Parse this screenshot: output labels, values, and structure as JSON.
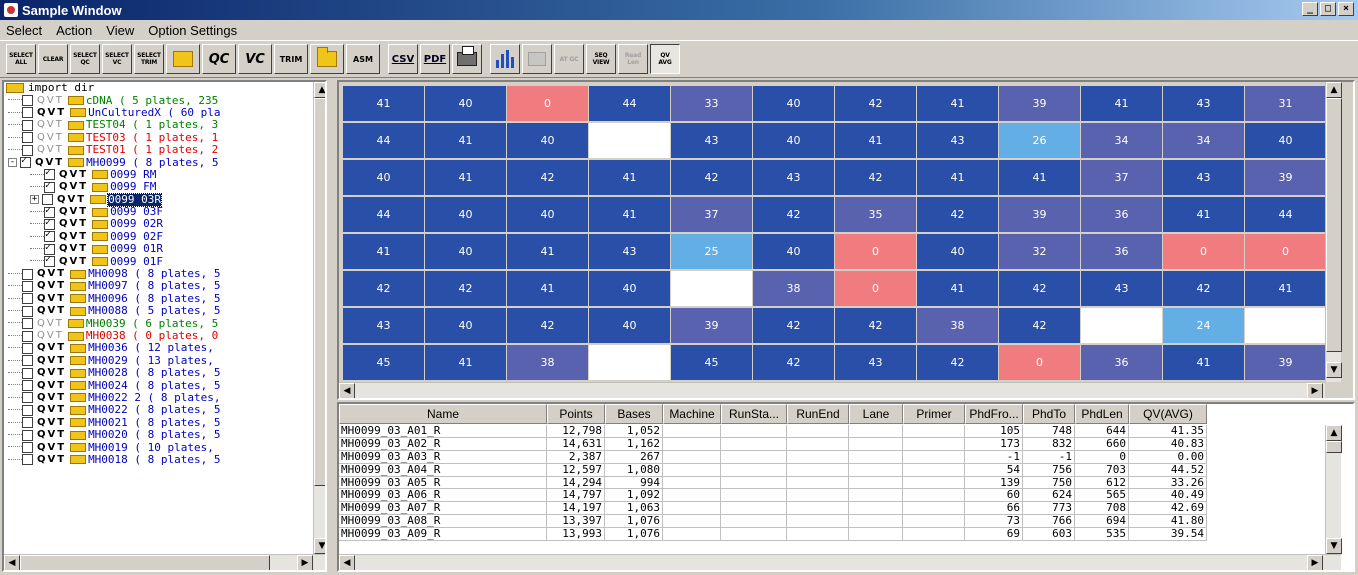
{
  "window": {
    "title": "Sample Window",
    "controls": [
      "_",
      "□",
      "×"
    ]
  },
  "menu": [
    "Select",
    "Action",
    "View",
    "Option Settings"
  ],
  "toolbar": {
    "select_all": "SELECT ALL",
    "clear": "CLEAR",
    "select_qc": "SELECT QC",
    "select_vc": "SELECT VC",
    "select_trim": "SELECT TRIM",
    "qc": "QC",
    "vc": "VC",
    "trim": "TRIM",
    "asm": "ASM",
    "csv": "CSV",
    "pdf": "PDF",
    "seq_view": "SEQ VIEW",
    "read_len": "Read Len",
    "qv_avg": "QV AVG",
    "at_gc": "AT GC"
  },
  "tree": {
    "root": "import dir",
    "items": [
      {
        "label": "cDNA ( 5 plates, 235",
        "checked": false,
        "dim": true,
        "color": "#008000",
        "level": 0
      },
      {
        "label": "UnCulturedX ( 60 pla",
        "checked": false,
        "dim": false,
        "color": "#0000c0",
        "level": 0
      },
      {
        "label": "TEST04 ( 1 plates, 3",
        "checked": false,
        "dim": true,
        "color": "#008000",
        "level": 0
      },
      {
        "label": "TEST03 ( 1 plates, 1",
        "checked": false,
        "dim": true,
        "color": "#e00000",
        "level": 0
      },
      {
        "label": "TEST01 ( 1 plates, 2",
        "checked": false,
        "dim": true,
        "color": "#e00000",
        "level": 0
      },
      {
        "label": "MH0099 ( 8 plates, 5",
        "checked": true,
        "dim": false,
        "color": "#0000c0",
        "level": 0,
        "expander": "-"
      },
      {
        "label": "0099 RM",
        "checked": true,
        "dim": false,
        "color": "#0000c0",
        "level": 1
      },
      {
        "label": "0099 FM",
        "checked": true,
        "dim": false,
        "color": "#0000c0",
        "level": 1
      },
      {
        "label": "0099 03R",
        "checked": false,
        "dim": false,
        "color": "#0000c0",
        "level": 1,
        "expander": "+",
        "selected": true
      },
      {
        "label": "0099 03F",
        "checked": true,
        "dim": false,
        "color": "#0000c0",
        "level": 1
      },
      {
        "label": "0099 02R",
        "checked": true,
        "dim": false,
        "color": "#0000c0",
        "level": 1
      },
      {
        "label": "0099 02F",
        "checked": true,
        "dim": false,
        "color": "#0000c0",
        "level": 1
      },
      {
        "label": "0099 01R",
        "checked": true,
        "dim": false,
        "color": "#0000c0",
        "level": 1
      },
      {
        "label": "0099 01F",
        "checked": true,
        "dim": false,
        "color": "#0000c0",
        "level": 1
      },
      {
        "label": "MH0098 ( 8 plates, 5",
        "checked": false,
        "dim": false,
        "color": "#0000c0",
        "level": 0
      },
      {
        "label": "MH0097 ( 8 plates, 5",
        "checked": false,
        "dim": false,
        "color": "#0000c0",
        "level": 0
      },
      {
        "label": "MH0096 ( 8 plates, 5",
        "checked": false,
        "dim": false,
        "color": "#0000c0",
        "level": 0
      },
      {
        "label": "MH0088 ( 5 plates, 5",
        "checked": false,
        "dim": false,
        "color": "#0000c0",
        "level": 0
      },
      {
        "label": "MH0039 ( 6 plates, 5",
        "checked": false,
        "dim": true,
        "color": "#008000",
        "level": 0
      },
      {
        "label": "MH0038 ( 0 plates, 0",
        "checked": false,
        "dim": true,
        "color": "#e00000",
        "level": 0
      },
      {
        "label": "MH0036 ( 12 plates,",
        "checked": false,
        "dim": false,
        "color": "#0000c0",
        "level": 0
      },
      {
        "label": "MH0029 ( 13 plates,",
        "checked": false,
        "dim": false,
        "color": "#0000c0",
        "level": 0
      },
      {
        "label": "MH0028 ( 8 plates, 5",
        "checked": false,
        "dim": false,
        "color": "#0000c0",
        "level": 0
      },
      {
        "label": "MH0024 ( 8 plates, 5",
        "checked": false,
        "dim": false,
        "color": "#0000c0",
        "level": 0
      },
      {
        "label": "MH0022 2 ( 8 plates,",
        "checked": false,
        "dim": false,
        "color": "#0000c0",
        "level": 0
      },
      {
        "label": "MH0022 ( 8 plates, 5",
        "checked": false,
        "dim": false,
        "color": "#0000c0",
        "level": 0
      },
      {
        "label": "MH0021 ( 8 plates, 5",
        "checked": false,
        "dim": false,
        "color": "#0000c0",
        "level": 0
      },
      {
        "label": "MH0020 ( 8 plates, 5",
        "checked": false,
        "dim": false,
        "color": "#0000c0",
        "level": 0
      },
      {
        "label": "MH0019 ( 10 plates,",
        "checked": false,
        "dim": false,
        "color": "#0000c0",
        "level": 0
      },
      {
        "label": "MH0018 ( 8 plates, 5",
        "checked": false,
        "dim": false,
        "color": "#0000c0",
        "level": 0
      }
    ]
  },
  "heatmap": {
    "colors": {
      "dark": "#2a4fa8",
      "mid": "#5962ae",
      "light": "#64aee6",
      "zero": "#f07c80",
      "empty": "#ffffff"
    },
    "rows": [
      [
        "41",
        "40",
        "0",
        "44",
        "33",
        "40",
        "42",
        "41",
        "39",
        "41",
        "43",
        "31"
      ],
      [
        "44",
        "41",
        "40",
        "",
        "43",
        "40",
        "41",
        "43",
        "26",
        "34",
        "34",
        "40"
      ],
      [
        "40",
        "41",
        "42",
        "41",
        "42",
        "43",
        "42",
        "41",
        "41",
        "37",
        "43",
        "39"
      ],
      [
        "44",
        "40",
        "40",
        "41",
        "37",
        "42",
        "35",
        "42",
        "39",
        "36",
        "41",
        "44"
      ],
      [
        "41",
        "40",
        "41",
        "43",
        "25",
        "40",
        "0",
        "40",
        "32",
        "36",
        "0",
        "0"
      ],
      [
        "42",
        "42",
        "41",
        "40",
        "",
        "38",
        "0",
        "41",
        "42",
        "43",
        "42",
        "41"
      ],
      [
        "43",
        "40",
        "42",
        "40",
        "39",
        "42",
        "42",
        "38",
        "42",
        "",
        "24",
        ""
      ],
      [
        "45",
        "41",
        "38",
        "",
        "45",
        "42",
        "43",
        "42",
        "0",
        "36",
        "41",
        "39"
      ]
    ]
  },
  "table": {
    "columns": [
      "Name",
      "Points",
      "Bases",
      "Machine",
      "RunSta...",
      "RunEnd",
      "Lane",
      "Primer",
      "PhdFro...",
      "PhdTo",
      "PhdLen",
      "QV(AVG)"
    ],
    "rows": [
      [
        "MH0099_03_A01_R",
        "12,798",
        "1,052",
        "",
        "",
        "",
        "",
        "",
        "105",
        "748",
        "644",
        "41.35"
      ],
      [
        "MH0099_03_A02_R",
        "14,631",
        "1,162",
        "",
        "",
        "",
        "",
        "",
        "173",
        "832",
        "660",
        "40.83"
      ],
      [
        "MH0099_03_A03_R",
        "2,387",
        "267",
        "",
        "",
        "",
        "",
        "",
        "-1",
        "-1",
        "0",
        "0.00"
      ],
      [
        "MH0099_03_A04_R",
        "12,597",
        "1,080",
        "",
        "",
        "",
        "",
        "",
        "54",
        "756",
        "703",
        "44.52"
      ],
      [
        "MH0099_03_A05_R",
        "14,294",
        "994",
        "",
        "",
        "",
        "",
        "",
        "139",
        "750",
        "612",
        "33.26"
      ],
      [
        "MH0099_03_A06_R",
        "14,797",
        "1,092",
        "",
        "",
        "",
        "",
        "",
        "60",
        "624",
        "565",
        "40.49"
      ],
      [
        "MH0099_03_A07_R",
        "14,197",
        "1,063",
        "",
        "",
        "",
        "",
        "",
        "66",
        "773",
        "708",
        "42.69"
      ],
      [
        "MH0099_03_A08_R",
        "13,397",
        "1,076",
        "",
        "",
        "",
        "",
        "",
        "73",
        "766",
        "694",
        "41.80"
      ],
      [
        "MH0099_03_A09_R",
        "13,993",
        "1,076",
        "",
        "",
        "",
        "",
        "",
        "69",
        "603",
        "535",
        "39.54"
      ]
    ]
  }
}
